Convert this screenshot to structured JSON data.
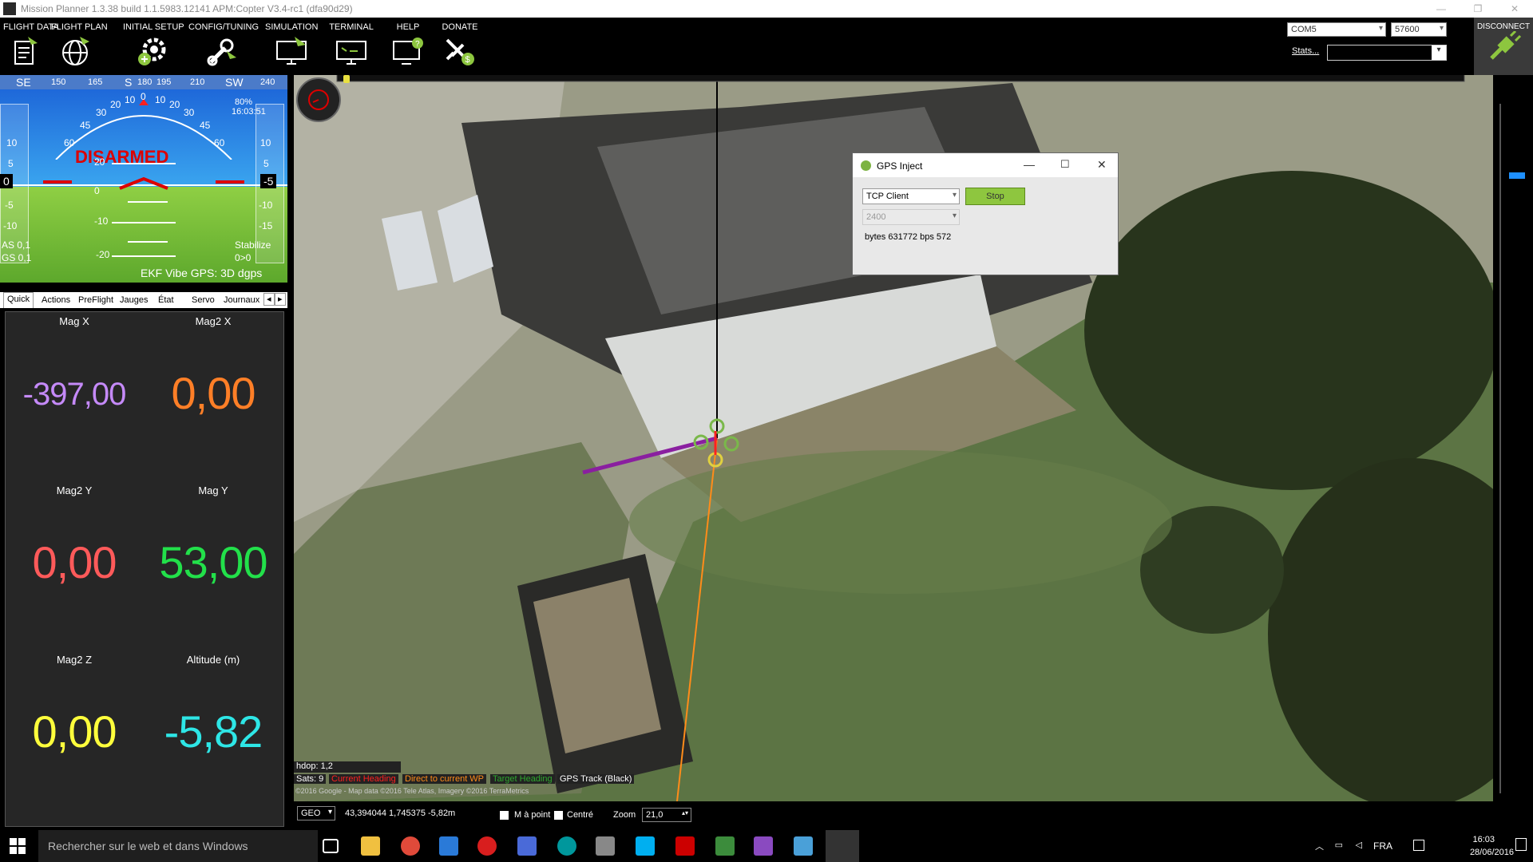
{
  "window": {
    "title": "Mission Planner 1.3.38 build 1.1.5983.12141 APM:Copter V3.4-rc1 (dfa90d29)",
    "minimize": "—",
    "restore": "❐",
    "close": "✕"
  },
  "menu": {
    "items": [
      {
        "label": "FLIGHT DATA",
        "icon": "clipboard-plane-icon"
      },
      {
        "label": "FLIGHT PLAN",
        "icon": "globe-icon"
      },
      {
        "label": "INITIAL SETUP",
        "icon": "gear-plus-icon"
      },
      {
        "label": "CONFIG/TUNING",
        "icon": "wrench-plane-icon"
      },
      {
        "label": "SIMULATION",
        "icon": "monitor-plane-icon"
      },
      {
        "label": "TERMINAL",
        "icon": "terminal-monitor-icon"
      },
      {
        "label": "HELP",
        "icon": "monitor-help-icon"
      },
      {
        "label": "DONATE",
        "icon": "plane-dollar-icon"
      }
    ]
  },
  "connection": {
    "port": "COM5",
    "baud": "57600",
    "stats_label": "Stats...",
    "disconnect_label": "DISCONNECT"
  },
  "hud": {
    "compass": [
      "SE",
      "150",
      "165",
      "S",
      "180",
      "195",
      "210",
      "SW",
      "240"
    ],
    "status": "DISARMED",
    "time": "16:03:51",
    "battery": "80%",
    "airspeed": "AS 0,1",
    "groundspeed": "GS 0,1",
    "mode": "Stabilize",
    "mode_sub": "0>0",
    "bottom": "EKF  Vibe  GPS: 3D dgps",
    "left_value": "0",
    "right_value": "-5",
    "speed_ticks": [
      "10",
      "5",
      "-5",
      "-10"
    ],
    "alt_ticks": [
      "10",
      "5",
      "-10",
      "-15"
    ],
    "pitch_labels": [
      "20",
      "0",
      "-10",
      "-20"
    ],
    "roll_labels": [
      "60",
      "45",
      "30",
      "20",
      "10",
      "0",
      "10",
      "20",
      "30",
      "45",
      "60"
    ]
  },
  "tabs": [
    "Quick",
    "Actions",
    "PreFlight",
    "Jauges",
    "État",
    "Servo",
    "Journaux"
  ],
  "quick": [
    {
      "label": "Mag X",
      "value": "-397,00",
      "color": "#c58af9"
    },
    {
      "label": "Mag2 X",
      "value": "0,00",
      "color": "#ff7f27"
    },
    {
      "label": "Mag2 Y",
      "value": "0,00",
      "color": "#ff5a5a"
    },
    {
      "label": "Mag Y",
      "value": "53,00",
      "color": "#22e04a"
    },
    {
      "label": "Mag2 Z",
      "value": "0,00",
      "color": "#ffff3c"
    },
    {
      "label": "Altitude (m)",
      "value": "-5,82",
      "color": "#2ee6e6"
    }
  ],
  "gps_inject": {
    "title": "GPS Inject",
    "mode": "TCP Client",
    "baud": "2400",
    "stop_label": "Stop",
    "stats": "bytes 631772 bps 572"
  },
  "map": {
    "hdop": "hdop: 1,2",
    "sats": "Sats: 9",
    "legend": [
      {
        "label": "Current Heading",
        "color": "#ff2020"
      },
      {
        "label": "Direct to current WP",
        "color": "#ff8c1a"
      },
      {
        "label": "Target Heading",
        "color": "#2ea82e"
      },
      {
        "label": "GPS Track (Black)",
        "color": "#ffffff"
      }
    ],
    "copyright": "©2016 Google - Map data ©2016 Tele Atlas, Imagery ©2016 TerraMetrics",
    "coord_type": "GEO",
    "coords": "43,394044 1,745375  -5,82m",
    "check1": "M à point",
    "check2": "Centré",
    "zoom_label": "Zoom",
    "zoom_value": "21,0"
  },
  "taskbar": {
    "search": "Rechercher sur le web et dans Windows",
    "lang": "FRA",
    "time": "16:03",
    "date": "28/06/2016"
  }
}
